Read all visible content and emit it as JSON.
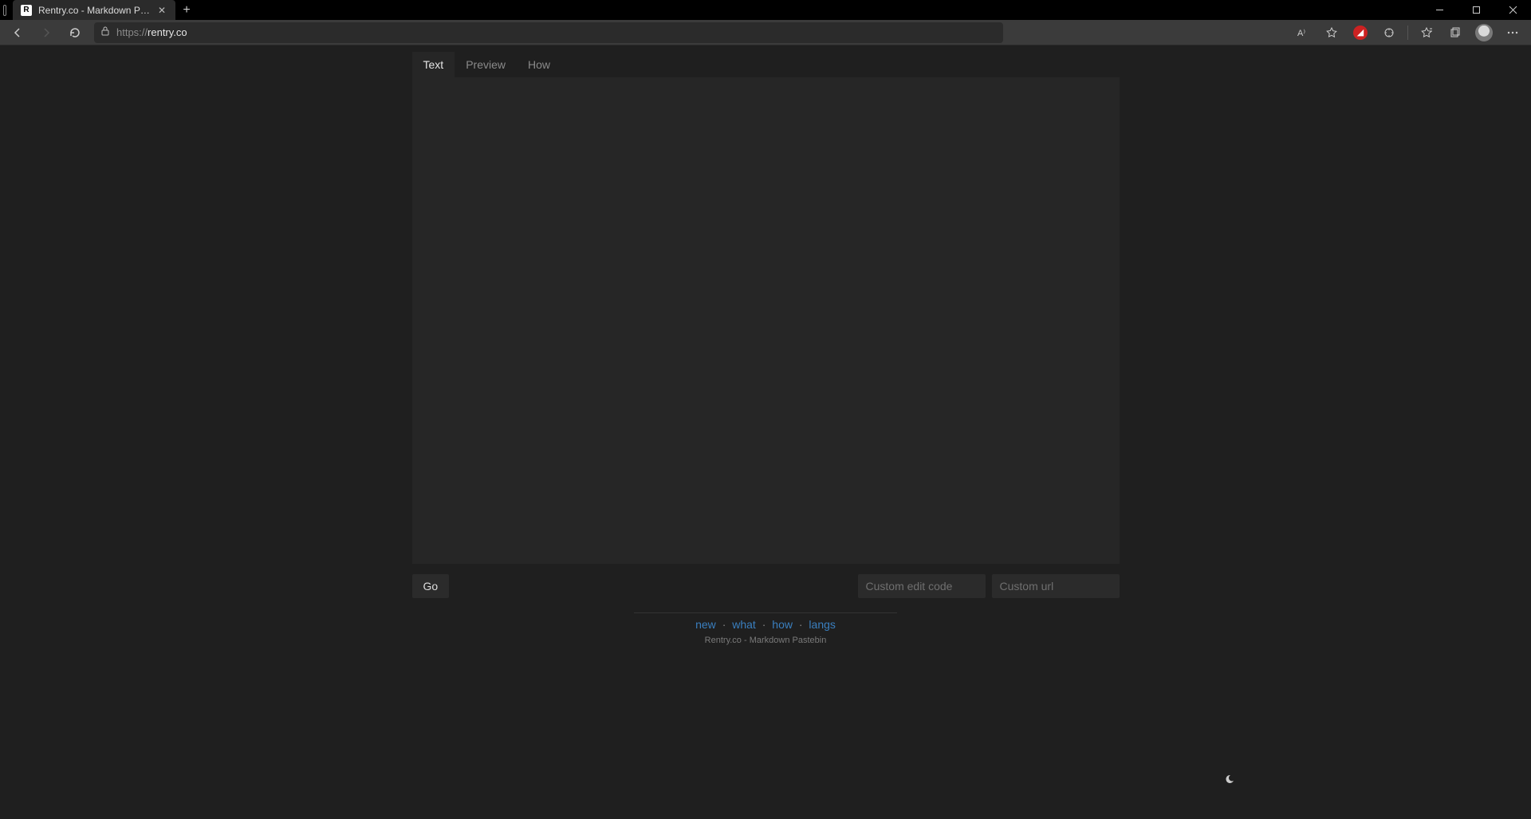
{
  "browser": {
    "tab": {
      "title": "Rentry.co - Markdown Pastebin",
      "favicon_letter": "R"
    },
    "url_protocol": "https://",
    "url_host": "rentry.co"
  },
  "tabs": {
    "text": "Text",
    "preview": "Preview",
    "how": "How"
  },
  "editor": {
    "value": ""
  },
  "actions": {
    "go": "Go",
    "editcode_placeholder": "Custom edit code",
    "editcode_value": "",
    "customurl_placeholder": "Custom url",
    "customurl_value": ""
  },
  "footer": {
    "links": {
      "new": "new",
      "what": "what",
      "how": "how",
      "langs": "langs"
    },
    "separator": "·",
    "tagline": "Rentry.co - Markdown Pastebin"
  }
}
